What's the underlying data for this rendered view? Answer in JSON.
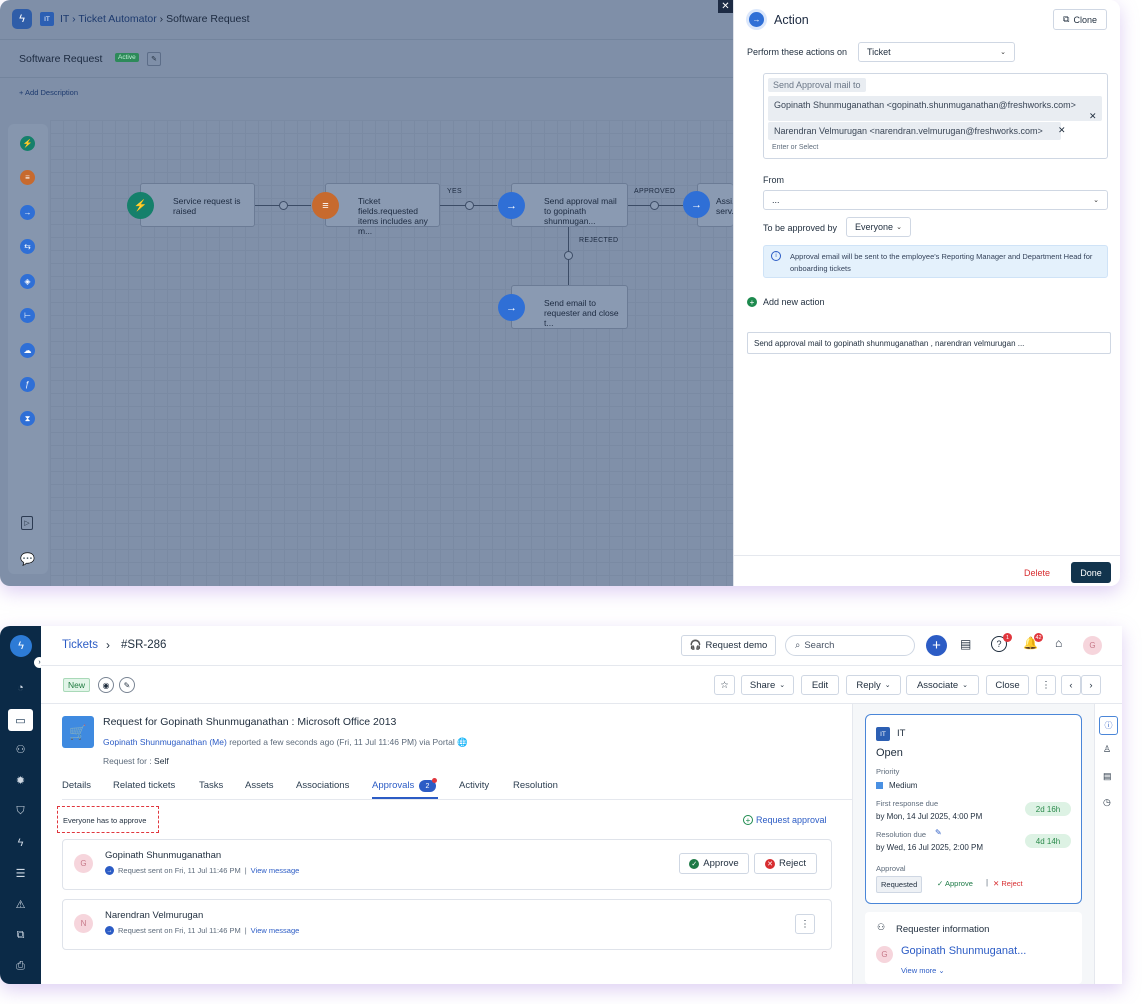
{
  "workflow": {
    "breadcrumb": {
      "module": "IT",
      "app": "Ticket Automator",
      "current": "Software Request"
    },
    "title": "Software Request",
    "status_badge": "Active",
    "add_description": "+ Add Description",
    "nodes": [
      {
        "label": "Service request is raised",
        "color": "#15806b",
        "icon": "bolt-icon"
      },
      {
        "label": "Ticket fields.requested items includes any m...",
        "color": "#c76a2e",
        "icon": "sliders-icon"
      },
      {
        "label": "Send approval mail to gopinath shunmugan...",
        "color": "#2f6fd6",
        "icon": "arrow-right-icon"
      },
      {
        "label": "Assi... serv...",
        "color": "#2f6fd6",
        "icon": "arrow-right-icon"
      },
      {
        "label": "Send email to requester and close t...",
        "color": "#2f6fd6",
        "icon": "arrow-right-icon"
      }
    ],
    "edge_labels": {
      "yes": "YES",
      "approved": "APPROVED",
      "rejected": "REJECTED"
    }
  },
  "action_panel": {
    "title": "Action",
    "clone_label": "Clone",
    "perform_label": "Perform these actions on",
    "perform_value": "Ticket",
    "recipients_header": "Send Approval mail to",
    "recipients": [
      "Gopinath Shunmuganathan <gopinath.shunmuganathan@freshworks.com>",
      "Narendran Velmurugan <narendran.velmurugan@freshworks.com>"
    ],
    "recipients_placeholder": "Enter or Select",
    "from_label": "From",
    "from_value": "...",
    "approved_by_label": "To be approved by",
    "approved_by_value": "Everyone",
    "info_text": "Approval email will be sent to the employee's Reporting Manager and Department Head for onboarding tickets",
    "add_new_action": "Add new action",
    "summary_text": "Send approval mail to gopinath shunmuganathan , narendran velmurugan  ...",
    "delete_label": "Delete",
    "done_label": "Done"
  },
  "ticket": {
    "breadcrumb_root": "Tickets",
    "ticket_id": "#SR-286",
    "request_demo": "Request demo",
    "search_placeholder": "Search",
    "notif_count_help": "1",
    "notif_count_bell": "42",
    "user_initial": "G",
    "status_tag": "New",
    "toolbar": {
      "share": "Share",
      "edit": "Edit",
      "reply": "Reply",
      "associate": "Associate",
      "close": "Close"
    },
    "subject": "Request for Gopinath Shunmuganathan : Microsoft Office 2013",
    "requester_link": "Gopinath Shunmuganathan (Me)",
    "reported_text": "reported a few seconds ago (Fri, 11 Jul 11:46 PM) via Portal",
    "request_for_label": "Request for :",
    "request_for_value": "Self",
    "tabs": [
      "Details",
      "Related tickets",
      "Tasks",
      "Assets",
      "Associations",
      "Approvals",
      "Activity",
      "Resolution"
    ],
    "approvals_count": "2",
    "everyone_note": "Everyone has to approve",
    "request_approval": "Request approval",
    "approvers": [
      {
        "initial": "G",
        "name": "Gopinath Shunmuganathan",
        "sent": "Request sent on Fri, 11 Jul 11:46 PM",
        "view": "View message",
        "approve": "Approve",
        "reject": "Reject"
      },
      {
        "initial": "N",
        "name": "Narendran Velmurugan",
        "sent": "Request sent on Fri, 11 Jul 11:46 PM",
        "view": "View message"
      }
    ],
    "summary_card": {
      "group_badge": "IT",
      "group": "IT",
      "status": "Open",
      "priority_label": "Priority",
      "priority_value": "Medium",
      "priority_color": "#4a90e2",
      "first_response_label": "First response due",
      "first_response_value": "by Mon, 14 Jul 2025, 4:00 PM",
      "first_response_sla": "2d 16h",
      "resolution_label": "Resolution due",
      "resolution_value": "by Wed, 16 Jul 2025, 2:00 PM",
      "resolution_sla": "4d 14h",
      "approval_label": "Approval",
      "approval_state": "Requested",
      "approve": "Approve",
      "reject": "Reject"
    },
    "requester_info": {
      "title": "Requester information",
      "initial": "G",
      "name": "Gopinath Shunmuganat...",
      "view_more": "View more"
    }
  }
}
